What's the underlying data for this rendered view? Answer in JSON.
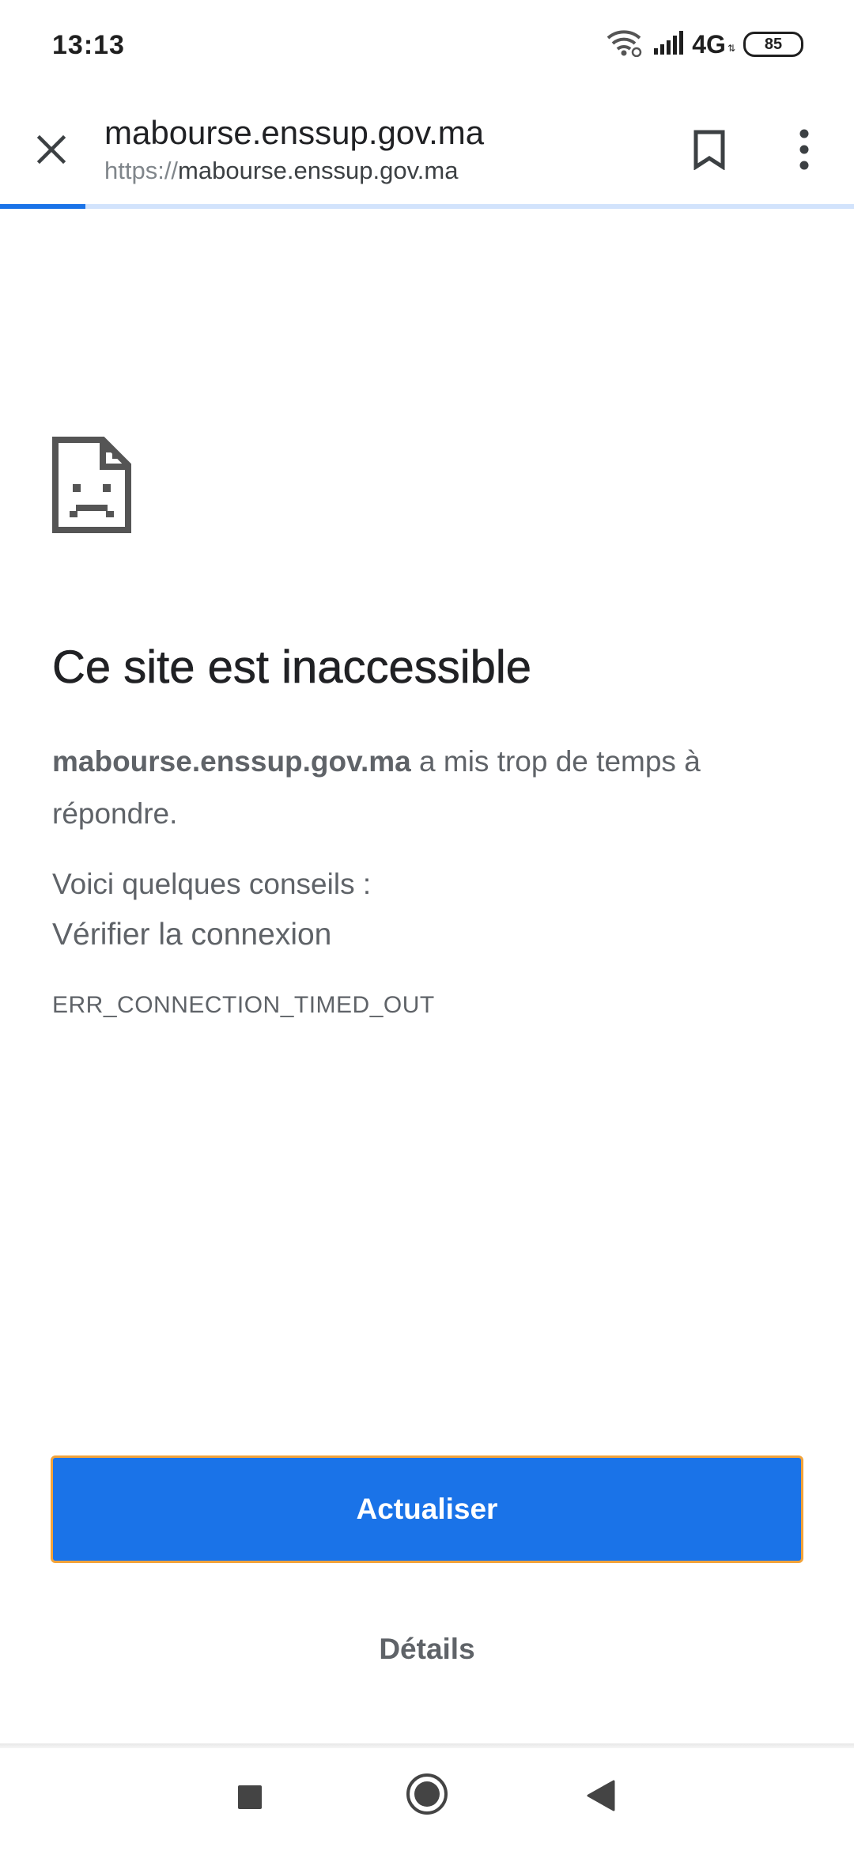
{
  "status_bar": {
    "time": "13:13",
    "network_label": "4G",
    "network_sub": "⇅",
    "battery": "85",
    "icons": [
      "wifi-icon",
      "signal-icon",
      "battery-icon"
    ]
  },
  "toolbar": {
    "title": "mabourse.enssup.gov.ma",
    "url_scheme": "https://",
    "url_host": "mabourse.enssup.gov.ma",
    "icons": [
      "close-icon",
      "bookmark-icon",
      "more-vert-icon"
    ],
    "progress_fraction": 0.1
  },
  "error_page": {
    "icon": "sad-page-icon",
    "heading": "Ce site est inaccessible",
    "host": "mabourse.enssup.gov.ma",
    "message_rest": " a mis trop de temps à répondre.",
    "suggestions_title": "Voici quelques conseils :",
    "suggestion_1": "Vérifier la connexion",
    "error_code": "ERR_CONNECTION_TIMED_OUT",
    "reload_label": "Actualiser",
    "details_label": "Détails"
  },
  "nav_bar": {
    "icons": [
      "recents-icon",
      "home-icon",
      "back-icon"
    ]
  },
  "colors": {
    "accent": "#1a73e8",
    "progress_track": "#d2e3fc",
    "focus_ring": "#f2a33a",
    "secondary_text": "#5f6368",
    "primary_text": "#202124"
  }
}
